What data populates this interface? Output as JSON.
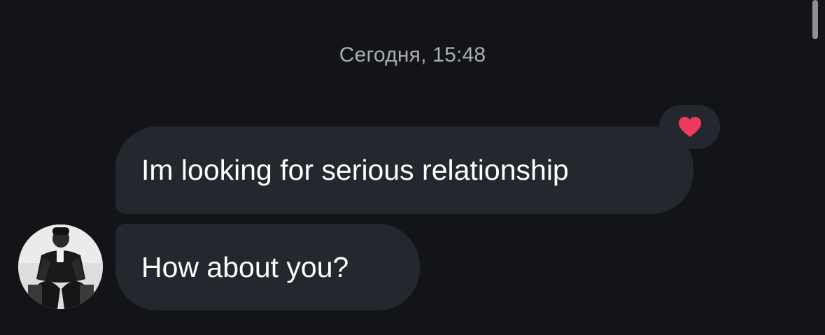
{
  "chat": {
    "timestamp": "Сегодня, 15:48",
    "messages": [
      {
        "text": "Im looking for serious relationship",
        "reaction": "heart-icon"
      },
      {
        "text": "How about you?"
      }
    ]
  },
  "avatar": {
    "icon": "avatar"
  },
  "colors": {
    "background": "#131418",
    "bubble": "#24272d",
    "timestamp": "#a9acb3",
    "heart": "#ef3b5b"
  }
}
